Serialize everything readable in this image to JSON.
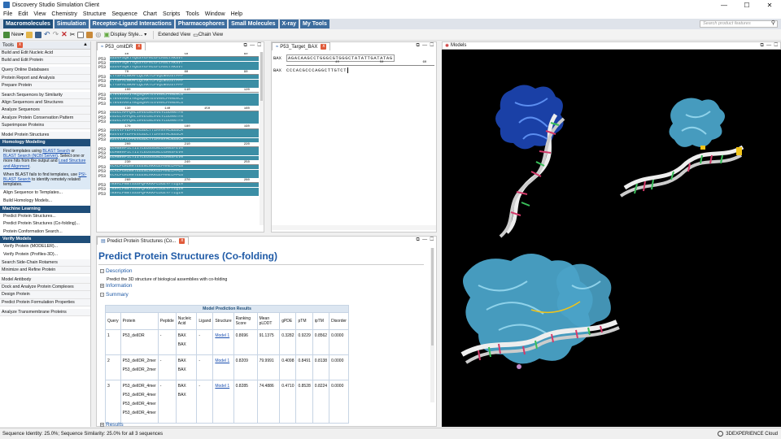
{
  "window": {
    "title": "Discovery Studio Simulation Client",
    "controls": [
      "—",
      "☐",
      "✕"
    ]
  },
  "menu": [
    "File",
    "Edit",
    "View",
    "Chemistry",
    "Structure",
    "Sequence",
    "Chart",
    "Scripts",
    "Tools",
    "Window",
    "Help"
  ],
  "ribbon_tabs": [
    "Macromolecules",
    "Simulation",
    "Receptor-Ligand Interactions",
    "Pharmacophores",
    "Small Molecules",
    "X-ray",
    "My Tools"
  ],
  "search": {
    "placeholder": "Search product features"
  },
  "toolbar": {
    "new_label": "New",
    "display_style": "Display Style...",
    "extended_view": "Extended View",
    "chain_view": "Chain View"
  },
  "tools_panel": {
    "title": "Tools",
    "items_top": [
      "Build and Edit Nucleic Acid",
      "Build and Edit Protein",
      "Query Online Databases",
      "Protein Report and Analysis",
      "Prepare Protein",
      "Search Sequences by Similarity",
      "Align Sequences and Structures",
      "Analyze Sequences",
      "Analyze Protein Conservation Pattern",
      "Superimpose Proteins",
      "Model Protein Structures"
    ],
    "homology_header": "Homology Modeling",
    "help1": {
      "pre": "Find templates using ",
      "link1": "BLAST Search",
      "mid1": " or ",
      "link2": "BLAST Search (NCBI Server)",
      "mid2": ". Select one or more hits from the output and ",
      "link3": "Load Structure and Alignment",
      "post": "."
    },
    "help2": {
      "pre": "When BLAST fails to find templates, use ",
      "link1": "PSI-BLAST Search",
      "post": " to identify remotely related templates."
    },
    "homology_items": [
      "Align Sequence to Templates...",
      "Build Homology Models..."
    ],
    "ml_header": "Machine Learning",
    "ml_items": [
      "Predict Protein Structures...",
      "Predict Protein Structures (Co-folding)...",
      "Protein Conformation Search..."
    ],
    "verify_header": "Verify Models",
    "verify_items": [
      "Verify Protein (MODELER)...",
      "Verify Protein (Profiles-3D)..."
    ],
    "items_bottom": [
      "Search Side-Chain Rotamers",
      "Minimize and Refine Protein",
      "Model Antibody",
      "Dock and Analyze Protein Complexes",
      "Design Protein",
      "Predict Protein Formulation Properties",
      "Analyze Transmembrane Proteins"
    ]
  },
  "seq_panel": {
    "tab": "P53_omitDR",
    "label": "P53",
    "blocks": [
      {
        "ruler": [
          "40",
          "50",
          "60"
        ],
        "rows": [
          "SSSVPSQKTYQGSYGFRLGFLHSGTAKSVT",
          "SSSVPSQKTYQGSYGFRLGFLHSGTAKSVT",
          "SSSVPSQKTYQGSYGFRLGFLHSGTAKSVT"
        ]
      },
      {
        "ruler": [
          "70",
          "80",
          "90"
        ],
        "rows": [
          "CTYSPALNKMFCQLAKTCPVQLWVDSTPPP",
          "CTYSPALNKMFCQLAKTCPVQLWVDSTPPP",
          "CTYSPALNKMFCQLAKTCPVQLWVDSTPPP"
        ]
      },
      {
        "ruler": [
          "100",
          "110",
          "120"
        ],
        "rows": [
          "GTRVRAMAIYKQSQHMTEVVRRCPHHERCS",
          "GTRVRAMAIYKQSQHMTEVVRRCPHHERCS",
          "GTRVRAMAIYKQSQHMTEVVRRCPHHERCS"
        ]
      },
      {
        "ruler": [
          "130",
          "140",
          "150",
          "160"
        ],
        "rows": [
          "DSDGLAPPQHLIRVEGNLRVEYLDDRNTFR",
          "DSDGLAPPQHLIRVEGNLRVEYLDDRNTFR",
          "DSDGLAPPQHLIRVEGNLRVEYLDDRNTFR"
        ]
      },
      {
        "ruler": [
          "170",
          "180",
          "190"
        ],
        "rows": [
          "HSVVVPYEPPEVGSDCTTIHYNYMCNSSCM",
          "HSVVVPYEPPEVGSDCTTIHYNYMCNSSCM",
          "HSVVVPYEPPEVGSDCTTIHYNYMCNSSCM"
        ]
      },
      {
        "ruler": [
          "200",
          "210",
          "220"
        ],
        "rows": [
          "GGMNRRPILTIITLEDSSGNLLGRNSFEVR",
          "GGMNRRPILTIITLEDSSGNLLGRNSFEVR",
          "GGMNRRPILTIITLEDSSGNLLGRNSFEVR"
        ]
      },
      {
        "ruler": [
          "230",
          "240",
          "250"
        ],
        "rows": [
          "VCACPGRDRRTEEENLRKKGEPHHELPPGS",
          "VCACPGRDRRTEEENLRKKGEPHHELPPGS",
          "VCACPGRDRRTEEENLRKKGEPHHELPPGS"
        ]
      },
      {
        "ruler": [
          "260",
          "270",
          "280"
        ],
        "rows": [
          "TKRALPNNTSSSPQPKKKPLDGEYFTLQIR",
          "TKRALPNNTSSSPQPKKKPLDGEYFTLQIR",
          "TKRALPNNTSSSPQPKKKPLDGEYFTLQIR"
        ]
      }
    ]
  },
  "target_panel": {
    "tab": "P53_Target_BAX",
    "label1": "BAX",
    "seq1": "AGACAAGCCTGGGCGTGGGCTATATTGATATAG",
    "label2": "BAX",
    "seq2": "CCCACGCCCAGGCTTGTCT",
    "ruler": [
      "10",
      "20",
      "30",
      "40",
      "50",
      "60"
    ]
  },
  "models_panel": {
    "tab": "Models"
  },
  "report": {
    "tab": "Predict Protein Structures (Co...",
    "title": "Predict Protein Structures (Co-folding)",
    "sections": {
      "description": "Description",
      "information": "Information",
      "summary": "Summary",
      "results": "Results"
    },
    "description_text": "Predict the 3D structure of biological assemblies with co-folding",
    "table": {
      "caption": "Model Prediction Results",
      "headers": [
        "Query",
        "Protein",
        "Peptide",
        "Nucleic Acid",
        "Ligand",
        "Structure",
        "Ranking Score",
        "Mean pLDDT",
        "gPDE",
        "pTM",
        "ipTM",
        "Disorder"
      ],
      "rows": [
        {
          "query": "1",
          "protein": [
            "P53_delIDR"
          ],
          "peptide": "-",
          "nucleic": [
            "BAX",
            "BAX"
          ],
          "ligand": "-",
          "structure": "Model 1",
          "ranking": "0.8696",
          "plddt": "91.1375",
          "gpde": "0.3282",
          "ptm": "0.9229",
          "iptm": "0.8562",
          "disorder": "0.0000"
        },
        {
          "query": "2",
          "protein": [
            "P53_delIDR_2mer",
            "P53_delIDR_2mer"
          ],
          "peptide": "-",
          "nucleic": [
            "BAX",
            "BAX"
          ],
          "ligand": "-",
          "structure": "Model 1",
          "ranking": "0.8209",
          "plddt": "79.9991",
          "gpde": "0.4098",
          "ptm": "0.8491",
          "iptm": "0.8138",
          "disorder": "0.0000"
        },
        {
          "query": "3",
          "protein": [
            "P53_delIDR_4mer",
            "P53_delIDR_4mer",
            "P53_delIDR_4mer",
            "P53_delIDR_4mer"
          ],
          "peptide": "-",
          "nucleic": [
            "BAX",
            "BAX"
          ],
          "ligand": "-",
          "structure": "Model 1",
          "ranking": "0.8285",
          "plddt": "74.4886",
          "gpde": "0.4710",
          "ptm": "0.8528",
          "iptm": "0.8224",
          "disorder": "0.0000"
        }
      ]
    }
  },
  "status": {
    "text": "Sequence Identity: 25.0%; Sequence Similarity: 25.0% for all 3 sequences",
    "cloud": "3DEXPERIENCE Cloud"
  },
  "colors": {
    "accent": "#1f4e79",
    "ribbon": "#3d6d9e",
    "seq_fill": "#3b8ea5",
    "protein": "#4aa3c8",
    "protein_blue": "#1d47b8",
    "dna": "#e8e8e8"
  }
}
